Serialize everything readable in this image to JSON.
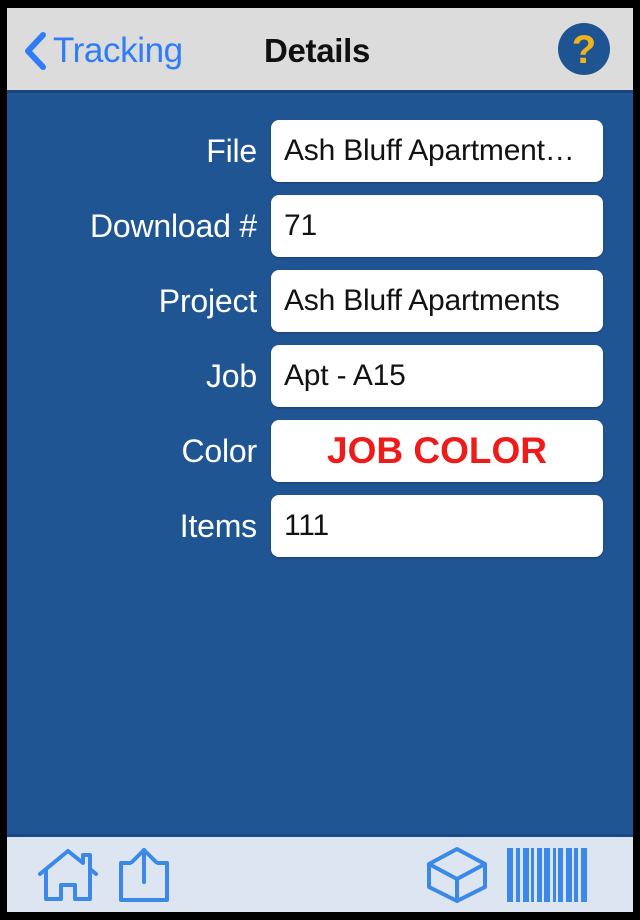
{
  "app": {
    "accent_blue": "#2F7CF6",
    "background_blue": "#205593",
    "nav_background": "#DCDCDC",
    "toolbar_background": "#DCE5F0",
    "field_background": "#FFFFFF",
    "alert_red": "#EE1B1B",
    "help_badge_yellow": "#F0B41A"
  },
  "nav": {
    "back_label": "Tracking",
    "back_icon": "chevron-left-icon",
    "title": "Details",
    "help_icon": "question-mark-circle-icon"
  },
  "form": {
    "rows": [
      {
        "label": "File",
        "value": "Ash Bluff Apartment…",
        "style": "normal"
      },
      {
        "label": "Download #",
        "value": "71",
        "style": "normal"
      },
      {
        "label": "Project",
        "value": "Ash Bluff Apartments",
        "style": "normal"
      },
      {
        "label": "Job",
        "value": "Apt - A15",
        "style": "normal"
      },
      {
        "label": "Color",
        "value": "JOB COLOR",
        "style": "accent"
      },
      {
        "label": "Items",
        "value": "111",
        "style": "normal"
      }
    ]
  },
  "toolbar": {
    "items": [
      {
        "name": "home",
        "icon": "home-icon",
        "label": "Home"
      },
      {
        "name": "share",
        "icon": "share-icon",
        "label": "Share"
      },
      {
        "name": "package",
        "icon": "cube-icon",
        "label": "Package"
      },
      {
        "name": "scan",
        "icon": "barcode-icon",
        "label": "Scan Barcode"
      }
    ]
  }
}
